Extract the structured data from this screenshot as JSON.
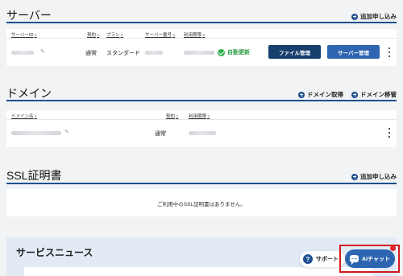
{
  "server": {
    "title": "サーバー",
    "add_label": "追加申し込み",
    "columns": [
      "サーバーID",
      "契約",
      "プラン",
      "サーバー番号",
      "利用期限"
    ],
    "row": {
      "contract": "通常",
      "plan": "スタンダード",
      "auto_renew": "自動更新",
      "file_button": "ファイル管理",
      "server_button": "サーバー管理"
    }
  },
  "domain": {
    "title": "ドメイン",
    "get_label": "ドメイン取得",
    "transfer_label": "ドメイン移管",
    "columns": [
      "ドメイン名",
      "契約",
      "利用期限"
    ],
    "row": {
      "contract": "通常"
    }
  },
  "ssl": {
    "title": "SSL証明書",
    "add_label": "追加申し込み",
    "empty_message": "ご利用中のSSL証明書はありません。"
  },
  "news": {
    "title": "サービスニュース"
  },
  "floating": {
    "support_label": "サポート",
    "ai_chat_label": "AIチャット"
  },
  "colors": {
    "accent": "#1f4f8f",
    "button_dark": "#173f6e",
    "button_mid": "#2d65b0",
    "auto_renew": "#2f9e44",
    "highlight": "#d0191f"
  },
  "icons": [
    "plus-icon",
    "sort-icon",
    "pencil-icon",
    "check-icon",
    "kebab-icon",
    "question-icon",
    "chat-icon"
  ]
}
